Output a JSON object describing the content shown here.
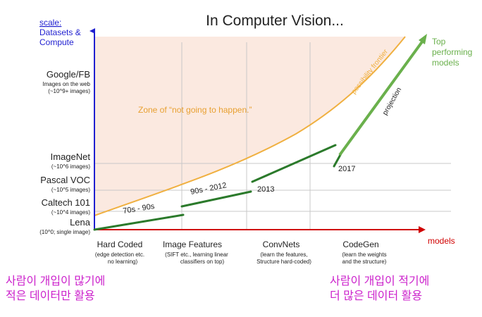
{
  "title": "In Computer Vision...",
  "y_axis": {
    "scale_label": "scale:",
    "label_lines": [
      "Datasets &",
      "Compute"
    ],
    "levels": [
      {
        "name": "Google/FB",
        "sub_lines": [
          "Images on the web",
          "(~10^9+ images)"
        ]
      },
      {
        "name": "ImageNet",
        "sub_lines": [
          "(~10^6 images)"
        ]
      },
      {
        "name": "Pascal VOC",
        "sub_lines": [
          "(~10^5 images)"
        ]
      },
      {
        "name": "Caltech 101",
        "sub_lines": [
          "(~10^4 images)"
        ]
      },
      {
        "name": "Lena",
        "sub_lines": [
          "(10^0; single image)"
        ]
      }
    ]
  },
  "x_axis": {
    "label": "models",
    "categories": [
      {
        "name": "Hard Coded",
        "sub_lines": [
          "(edge detection etc.",
          "no learning)"
        ]
      },
      {
        "name": "Image Features",
        "sub_lines": [
          "(SIFT etc., learning linear",
          "classifiers on top)"
        ]
      },
      {
        "name": "ConvNets",
        "sub_lines": [
          "(learn the features,",
          "Structure hard-coded)"
        ]
      },
      {
        "name": "CodeGen",
        "sub_lines": [
          "(learn the weights",
          "and the structure)"
        ]
      }
    ]
  },
  "zone_label": "Zone of “not going to happen.”",
  "frontier_label": "possibility frontier",
  "projection_label": "projection",
  "top_models_lines": [
    "Top",
    "performing",
    "models"
  ],
  "segments": [
    {
      "label": "70s - 90s"
    },
    {
      "label": "90s - 2012"
    },
    {
      "label": "2013"
    },
    {
      "label": "2017"
    }
  ],
  "korean_left_lines": [
    "사람이 개입이 많기에",
    "적은 데이터만 활용"
  ],
  "korean_right_lines": [
    "사람이 개입이 적기에",
    "더 많은 데이터 활용"
  ],
  "colors": {
    "axis_y": "#1f1fd0",
    "axis_x": "#d00000",
    "zone_fill": "#fbe9e0",
    "frontier": "#f0b040",
    "segment": "#2b7a2b",
    "projection": "#6ab04c",
    "korean": "#cc22cc",
    "grid": "#c8c8c8",
    "zone_text": "#e8a030",
    "top_models": "#6ab04c"
  }
}
